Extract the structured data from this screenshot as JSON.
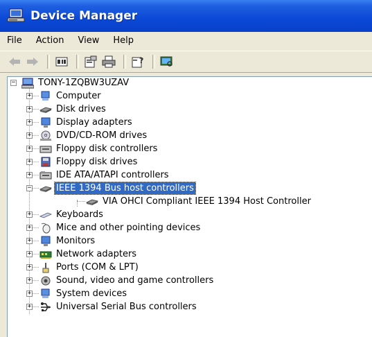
{
  "window": {
    "title": "Device Manager"
  },
  "menu": [
    "File",
    "Action",
    "View",
    "Help"
  ],
  "toolbar": {
    "buttons": [
      "back-icon",
      "forward-icon",
      "view-list-icon",
      "properties-icon",
      "print-icon",
      "help-icon",
      "scan-hardware-icon"
    ]
  },
  "tree": {
    "root": "TONY-1ZQBW3UZAV",
    "items": [
      {
        "label": "Computer",
        "icon": "computer-icon",
        "state": "collapsed"
      },
      {
        "label": "Disk drives",
        "icon": "disk-drive-icon",
        "state": "collapsed"
      },
      {
        "label": "Display adapters",
        "icon": "display-adapter-icon",
        "state": "collapsed"
      },
      {
        "label": "DVD/CD-ROM drives",
        "icon": "cdrom-icon",
        "state": "collapsed"
      },
      {
        "label": "Floppy disk controllers",
        "icon": "floppy-controller-icon",
        "state": "collapsed"
      },
      {
        "label": "Floppy disk drives",
        "icon": "floppy-drive-icon",
        "state": "collapsed"
      },
      {
        "label": "IDE ATA/ATAPI controllers",
        "icon": "ide-controller-icon",
        "state": "collapsed"
      },
      {
        "label": "IEEE 1394 Bus host controllers",
        "icon": "ieee1394-icon",
        "state": "expanded",
        "selected": true,
        "children": [
          {
            "label": "VIA OHCI Compliant IEEE 1394 Host Controller",
            "icon": "ieee1394-device-icon"
          }
        ]
      },
      {
        "label": "Keyboards",
        "icon": "keyboard-icon",
        "state": "collapsed"
      },
      {
        "label": "Mice and other pointing devices",
        "icon": "mouse-icon",
        "state": "collapsed"
      },
      {
        "label": "Monitors",
        "icon": "monitor-icon",
        "state": "collapsed"
      },
      {
        "label": "Network adapters",
        "icon": "network-adapter-icon",
        "state": "collapsed"
      },
      {
        "label": "Ports (COM & LPT)",
        "icon": "port-icon",
        "state": "collapsed"
      },
      {
        "label": "Sound, video and game controllers",
        "icon": "sound-icon",
        "state": "collapsed"
      },
      {
        "label": "System devices",
        "icon": "system-device-icon",
        "state": "collapsed"
      },
      {
        "label": "Universal Serial Bus controllers",
        "icon": "usb-icon",
        "state": "collapsed"
      }
    ]
  },
  "colors": {
    "title_bar": "#0a48d6",
    "selection": "#316ac5",
    "chrome": "#ece9d8"
  }
}
